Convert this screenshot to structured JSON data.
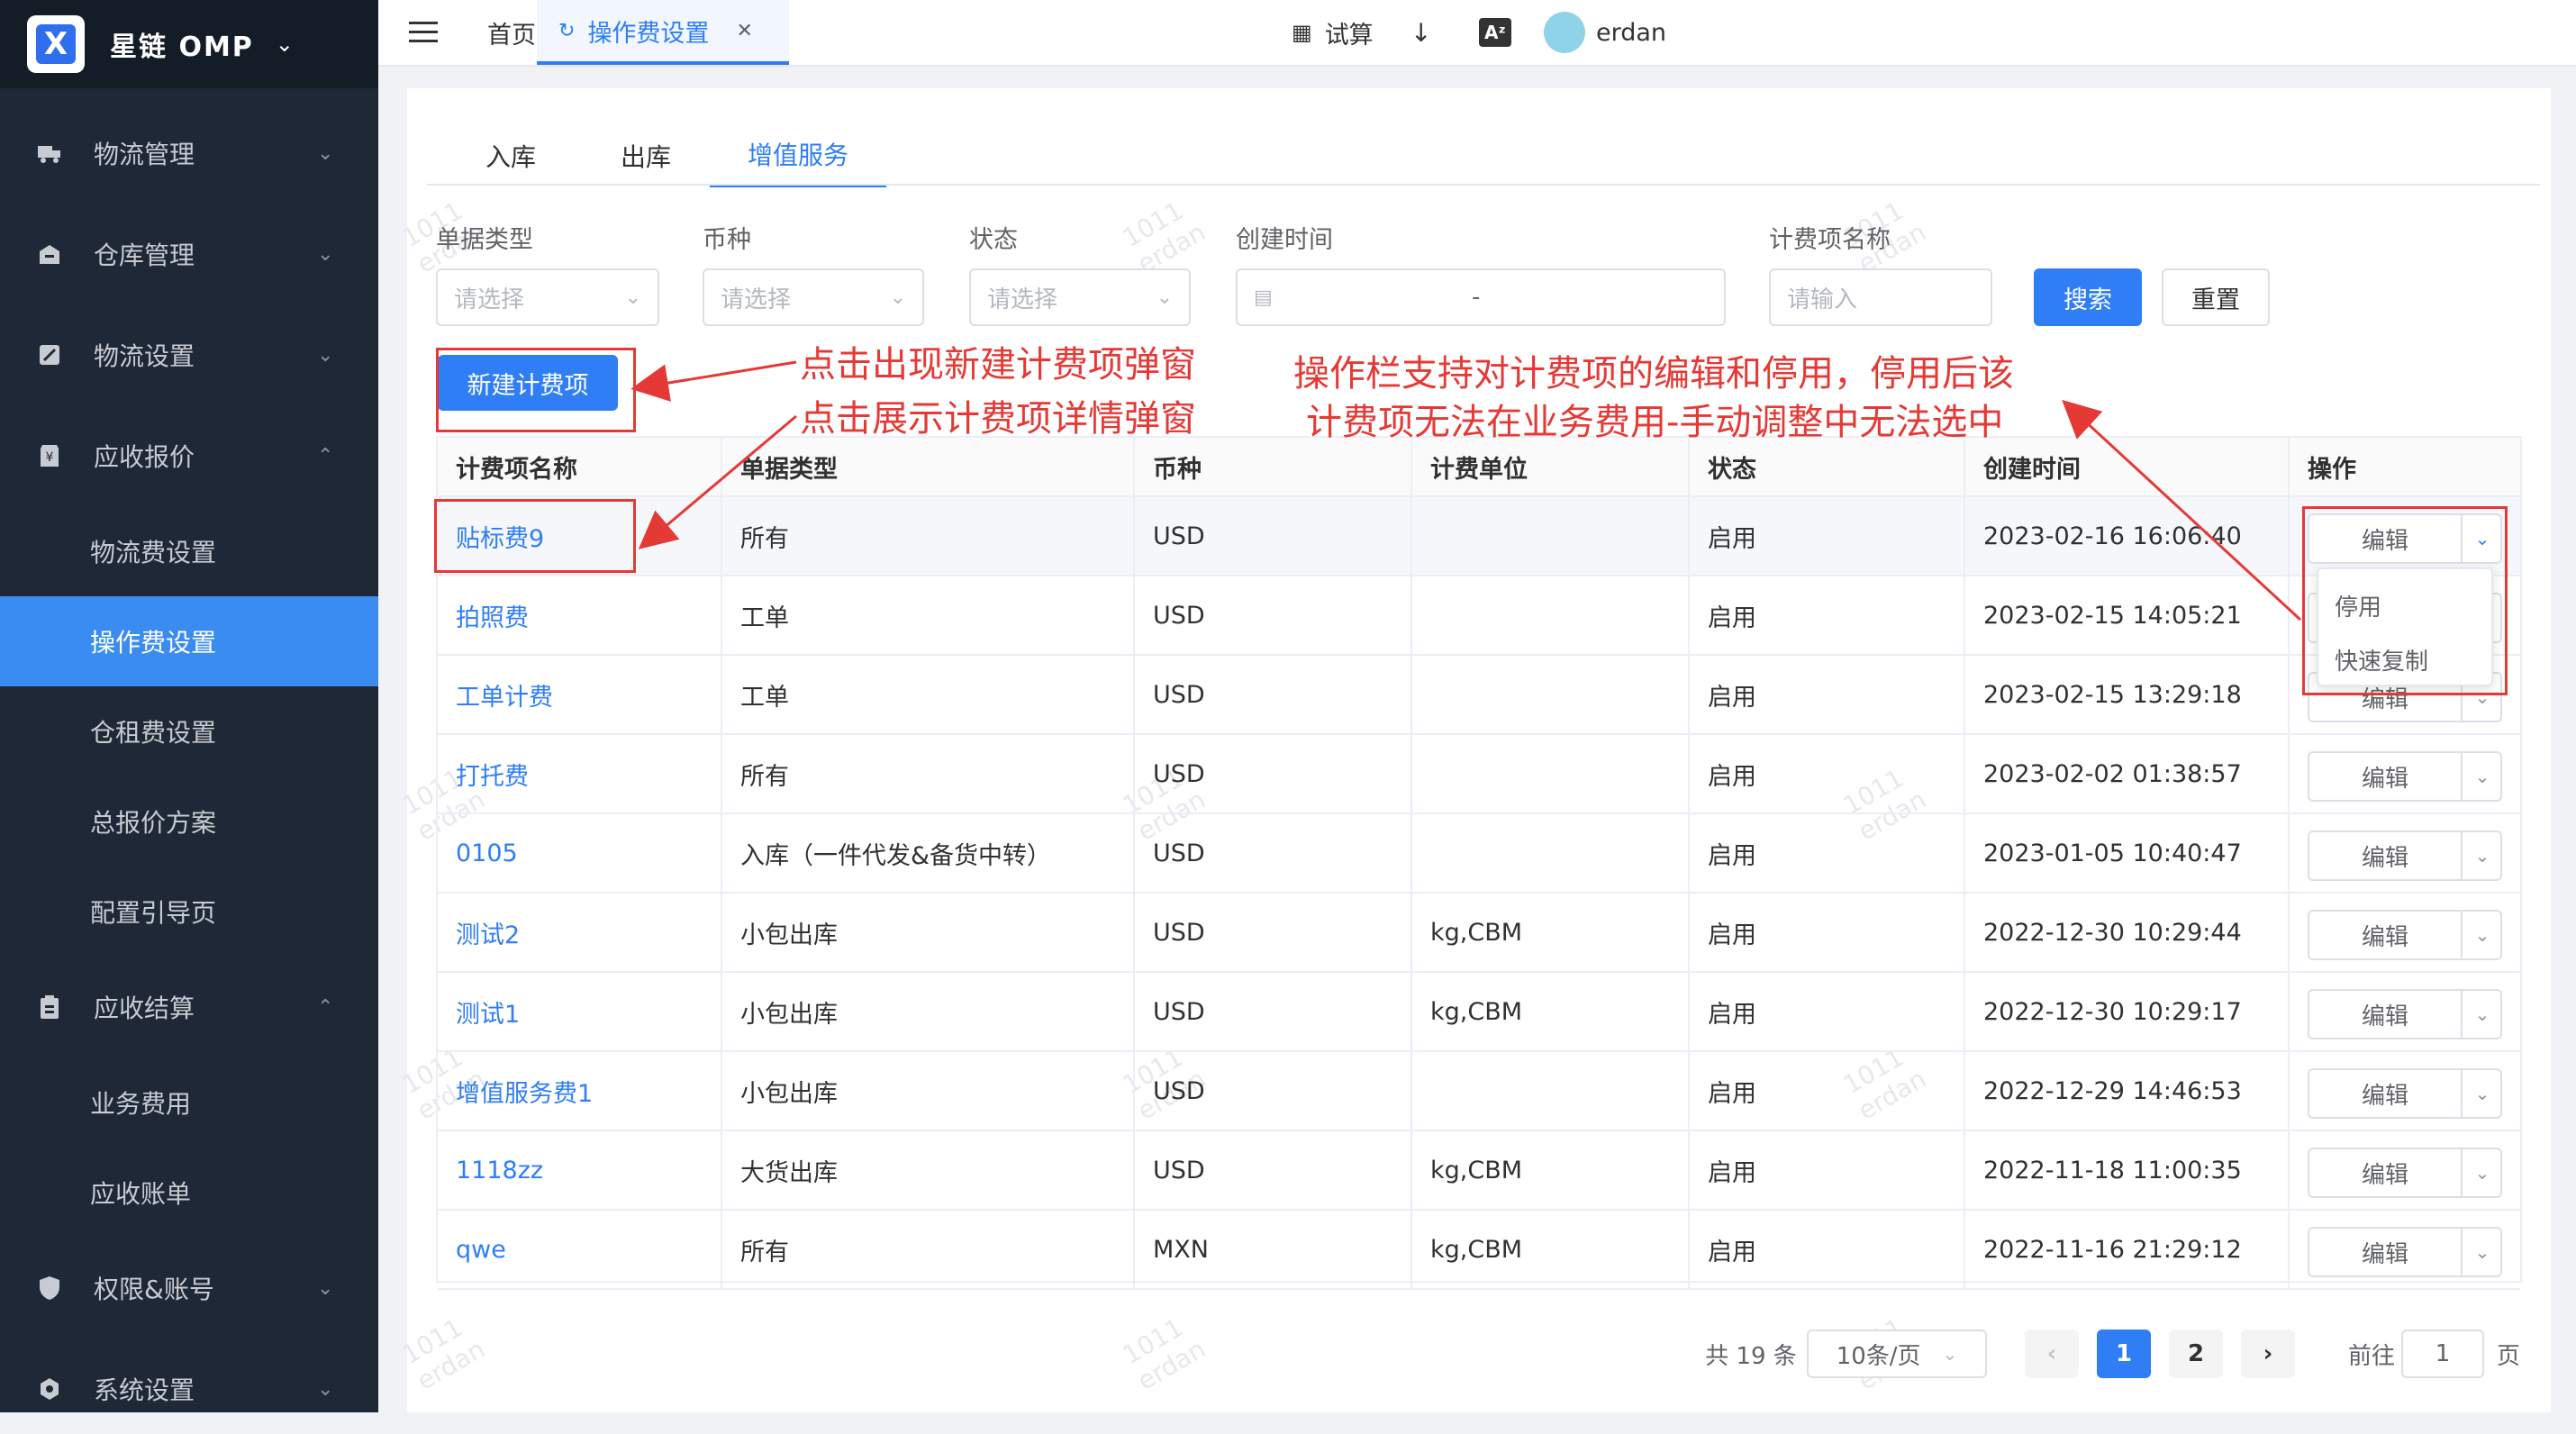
{
  "app": {
    "name": "星链 OMP"
  },
  "sidebar": {
    "items": [
      {
        "label": "物流管理",
        "icon": "truck-icon",
        "chevron": "⌄"
      },
      {
        "label": "仓库管理",
        "icon": "warehouse-icon",
        "chevron": "⌄"
      },
      {
        "label": "物流设置",
        "icon": "settings-icon",
        "chevron": "⌄"
      },
      {
        "label": "应收报价",
        "icon": "yen-icon",
        "chevron": "⌃"
      },
      {
        "label": "应收结算",
        "icon": "clipboard-icon",
        "chevron": "⌃"
      },
      {
        "label": "权限&账号",
        "icon": "shield-icon",
        "chevron": "⌄"
      },
      {
        "label": "系统设置",
        "icon": "gear-icon",
        "chevron": "⌄"
      }
    ],
    "sub_quote": [
      "物流费设置",
      "操作费设置",
      "仓租费设置",
      "总报价方案",
      "配置引导页"
    ],
    "sub_settle": [
      "业务费用",
      "应收账单"
    ],
    "active": "操作费设置"
  },
  "topbar": {
    "home_tab": "首页",
    "active_tab": "操作费设置",
    "calc": "试算",
    "user": "erdan"
  },
  "content_tabs": [
    "入库",
    "出库",
    "增值服务"
  ],
  "active_content_tab": "增值服务",
  "filters": {
    "doc_type": {
      "label": "单据类型",
      "placeholder": "请选择"
    },
    "currency": {
      "label": "币种",
      "placeholder": "请选择"
    },
    "status": {
      "label": "状态",
      "placeholder": "请选择"
    },
    "created": {
      "label": "创建时间",
      "sep": "-"
    },
    "fee_name": {
      "label": "计费项名称",
      "placeholder": "请输入"
    },
    "search": "搜索",
    "reset": "重置"
  },
  "new_button": "新建计费项",
  "table": {
    "headers": [
      "计费项名称",
      "单据类型",
      "币种",
      "计费单位",
      "状态",
      "创建时间",
      "操作"
    ],
    "rows": [
      {
        "name": "贴标费9",
        "doc_type": "所有",
        "currency": "USD",
        "unit": "",
        "status": "启用",
        "created": "2023-02-16 16:06:40"
      },
      {
        "name": "拍照费",
        "doc_type": "工单",
        "currency": "USD",
        "unit": "",
        "status": "启用",
        "created": "2023-02-15 14:05:21"
      },
      {
        "name": "工单计费",
        "doc_type": "工单",
        "currency": "USD",
        "unit": "",
        "status": "启用",
        "created": "2023-02-15 13:29:18"
      },
      {
        "name": "打托费",
        "doc_type": "所有",
        "currency": "USD",
        "unit": "",
        "status": "启用",
        "created": "2023-02-02 01:38:57"
      },
      {
        "name": "0105",
        "doc_type": "入库（一件代发&备货中转）",
        "currency": "USD",
        "unit": "",
        "status": "启用",
        "created": "2023-01-05 10:40:47"
      },
      {
        "name": "测试2",
        "doc_type": "小包出库",
        "currency": "USD",
        "unit": "kg,CBM",
        "status": "启用",
        "created": "2022-12-30 10:29:44"
      },
      {
        "name": "测试1",
        "doc_type": "小包出库",
        "currency": "USD",
        "unit": "kg,CBM",
        "status": "启用",
        "created": "2022-12-30 10:29:17"
      },
      {
        "name": "增值服务费1",
        "doc_type": "小包出库",
        "currency": "USD",
        "unit": "",
        "status": "启用",
        "created": "2022-12-29 14:46:53"
      },
      {
        "name": "1118zz",
        "doc_type": "大货出库",
        "currency": "USD",
        "unit": "kg,CBM",
        "status": "启用",
        "created": "2022-11-18 11:00:35"
      },
      {
        "name": "qwe",
        "doc_type": "所有",
        "currency": "MXN",
        "unit": "kg,CBM",
        "status": "启用",
        "created": "2022-11-16 21:29:12"
      }
    ],
    "edit_label": "编辑"
  },
  "dropdown": {
    "items": [
      "停用",
      "快速复制"
    ]
  },
  "pagination": {
    "total": "共 19 条",
    "page_size": "10条/页",
    "pages": [
      "1",
      "2"
    ],
    "current": "1",
    "goto_prefix": "前往",
    "goto_value": "1",
    "goto_suffix": "页"
  },
  "annotations": {
    "a1": "点击出现新建计费项弹窗",
    "a2": "点击展示计费项详情弹窗",
    "a3_line1": "操作栏支持对计费项的编辑和停用，停用后该",
    "a3_line2": "计费项无法在业务费用-手动调整中无法选中"
  },
  "watermark": {
    "line1": "1011",
    "line2": "erdan"
  },
  "colors": {
    "primary": "#2f7ef5",
    "sidebar": "#1f2836",
    "annotation": "#e53935"
  }
}
